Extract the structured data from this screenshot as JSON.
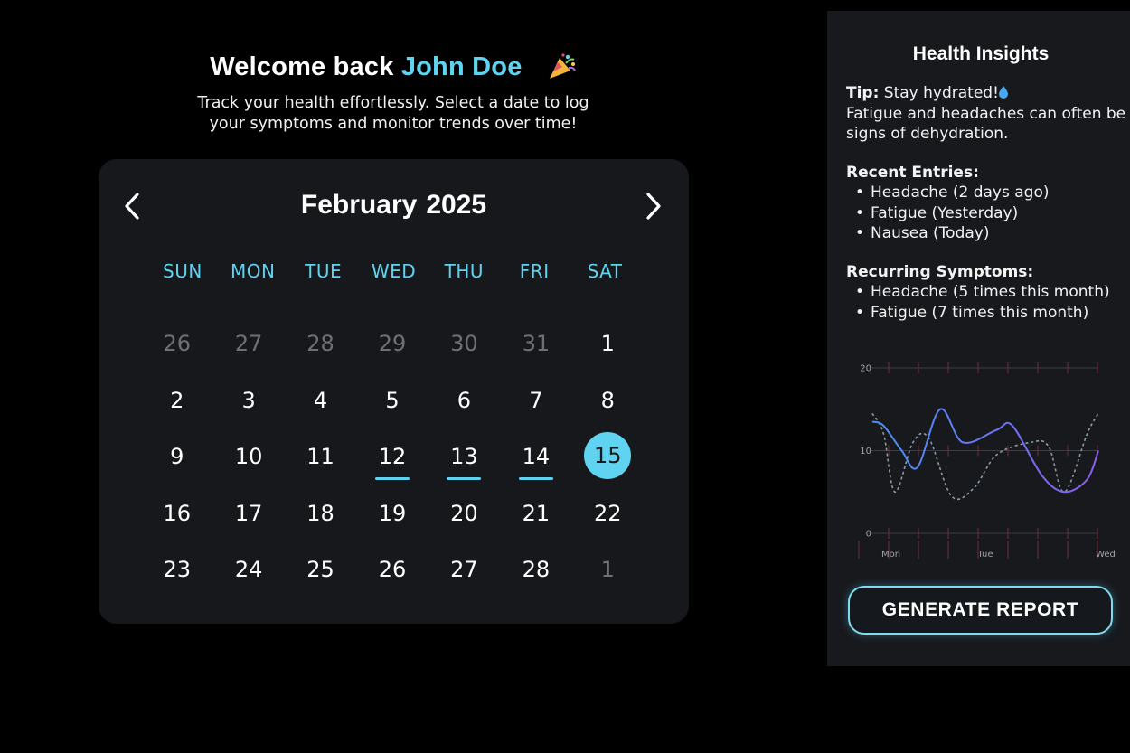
{
  "welcome": {
    "greeting": "Welcome back",
    "user_name": "John Doe",
    "subtitle": "Track your health effortlessly. Select a date to log your symptoms and monitor trends over time!"
  },
  "calendar": {
    "month": "February",
    "year": "2025",
    "weekdays": [
      "SUN",
      "MON",
      "TUE",
      "WED",
      "THU",
      "FRI",
      "SAT"
    ],
    "days": [
      {
        "label": "26",
        "state": "muted"
      },
      {
        "label": "27",
        "state": "muted"
      },
      {
        "label": "28",
        "state": "muted"
      },
      {
        "label": "29",
        "state": "muted"
      },
      {
        "label": "30",
        "state": "muted"
      },
      {
        "label": "31",
        "state": "muted"
      },
      {
        "label": "1",
        "state": "normal"
      },
      {
        "label": "2",
        "state": "normal"
      },
      {
        "label": "3",
        "state": "normal"
      },
      {
        "label": "4",
        "state": "normal"
      },
      {
        "label": "5",
        "state": "normal"
      },
      {
        "label": "6",
        "state": "normal"
      },
      {
        "label": "7",
        "state": "normal"
      },
      {
        "label": "8",
        "state": "normal"
      },
      {
        "label": "9",
        "state": "normal"
      },
      {
        "label": "10",
        "state": "normal"
      },
      {
        "label": "11",
        "state": "normal"
      },
      {
        "label": "12",
        "state": "marked"
      },
      {
        "label": "13",
        "state": "marked"
      },
      {
        "label": "14",
        "state": "marked"
      },
      {
        "label": "15",
        "state": "today"
      },
      {
        "label": "16",
        "state": "normal"
      },
      {
        "label": "17",
        "state": "normal"
      },
      {
        "label": "18",
        "state": "normal"
      },
      {
        "label": "19",
        "state": "normal"
      },
      {
        "label": "20",
        "state": "normal"
      },
      {
        "label": "21",
        "state": "normal"
      },
      {
        "label": "22",
        "state": "normal"
      },
      {
        "label": "23",
        "state": "normal"
      },
      {
        "label": "24",
        "state": "normal"
      },
      {
        "label": "25",
        "state": "normal"
      },
      {
        "label": "26",
        "state": "normal"
      },
      {
        "label": "27",
        "state": "normal"
      },
      {
        "label": "28",
        "state": "normal"
      },
      {
        "label": "1",
        "state": "muted"
      }
    ],
    "prev_icon": "chevron-left-icon",
    "next_icon": "chevron-right-icon"
  },
  "insights": {
    "title": "Health Insights",
    "tip_label": "Tip:",
    "tip_text": "Stay hydrated!",
    "tip_icon": "water-drop-icon",
    "tip_detail": "Fatigue and headaches can often be signs of dehydration.",
    "recent_title": "Recent Entries:",
    "recent_entries": [
      "Headache (2 days ago)",
      "Fatigue (Yesterday)",
      "Nausea (Today)"
    ],
    "recurring_title": "Recurring Symptoms:",
    "recurring_symptoms": [
      "Headache (5 times this month)",
      "Fatigue (7 times this month)"
    ],
    "report_button": "GENERATE REPORT"
  },
  "chart_data": {
    "type": "line",
    "x_labels": [
      "Mon",
      "Tue",
      "Wed"
    ],
    "y_ticks": [
      0,
      10,
      20
    ],
    "ylim": [
      0,
      20
    ],
    "grid": true,
    "series": [
      {
        "style": "solid",
        "color_start": "#4a90f5",
        "color_end": "#8a5cf0",
        "x": [
          0,
          0.05,
          0.13,
          0.2,
          0.3,
          0.4,
          0.55,
          0.62,
          0.75,
          0.85,
          0.95,
          1.0
        ],
        "y": [
          13.5,
          13,
          10,
          8,
          15,
          11,
          12.5,
          13,
          7,
          5,
          6.5,
          10
        ]
      },
      {
        "style": "dashed",
        "color": "#8c9aa8",
        "x": [
          0,
          0.05,
          0.1,
          0.18,
          0.25,
          0.35,
          0.45,
          0.55,
          0.7,
          0.78,
          0.85,
          0.95,
          1.0
        ],
        "y": [
          14.5,
          12,
          5,
          11,
          11.5,
          4.5,
          5.5,
          9.5,
          11,
          10.5,
          5,
          12,
          14.5
        ]
      }
    ]
  }
}
